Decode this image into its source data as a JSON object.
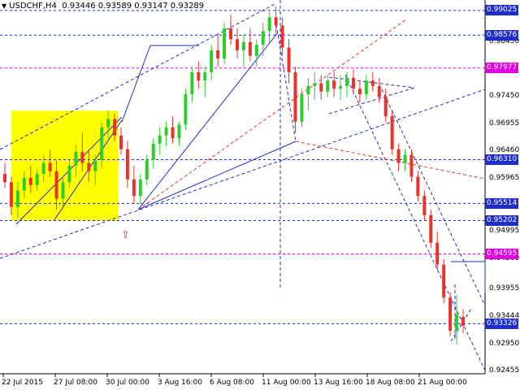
{
  "header": {
    "symbol": "USDCHF,H4",
    "ohlc": "0.93446 0.93589 0.93147 0.93289"
  },
  "chart_data": {
    "type": "candlestick",
    "title": "USDCHF,H4",
    "ohlc_text": "0.93446 0.93589 0.93147 0.93289",
    "ylim": [
      0.92415,
      0.99215
    ],
    "y_ticks": [
      "0.98450",
      "0.97450",
      "0.96955",
      "0.96460",
      "0.95965",
      "0.94995",
      "0.94500",
      "0.93955",
      "0.93444",
      "0.92950",
      "0.92455"
    ],
    "x_ticks": [
      "22 Jul 2015",
      "27 Jul 08:00",
      "30 Jul 00:00",
      "3 Aug 16:00",
      "6 Aug 08:00",
      "11 Aug 00:00",
      "13 Aug 16:00",
      "18 Aug 08:00",
      "21 Aug 00:00"
    ],
    "levels": [
      {
        "label": "0.99025",
        "value": 0.99025,
        "color": "#1f2ec8",
        "style": "dashed"
      },
      {
        "label": "0.98576",
        "value": 0.98576,
        "color": "#1f2ec8",
        "style": "dashed"
      },
      {
        "label": "0.97977",
        "value": 0.97977,
        "color": "#e000e0",
        "style": "dashed"
      },
      {
        "label": "0.96310",
        "value": 0.9631,
        "color": "#1f2ec8",
        "style": "dashed"
      },
      {
        "label": "0.95514",
        "value": 0.95514,
        "color": "#1f2ec8",
        "style": "dashed"
      },
      {
        "label": "0.95202",
        "value": 0.95202,
        "color": "#1f2ec8",
        "style": "dashed"
      },
      {
        "label": "0.94595",
        "value": 0.94595,
        "color": "#e000e0",
        "style": "dashed"
      },
      {
        "label": "0.93326",
        "value": 0.93326,
        "color": "#1f2ec8",
        "style": "dashed"
      }
    ],
    "series": [
      {
        "values": [
          [
            0.9605,
            0.9625,
            0.958,
            0.959
          ],
          [
            0.959,
            0.96,
            0.953,
            0.9545
          ],
          [
            0.9545,
            0.959,
            0.9525,
            0.9575
          ],
          [
            0.9575,
            0.961,
            0.956,
            0.9598
          ],
          [
            0.9598,
            0.962,
            0.957,
            0.9585
          ],
          [
            0.9585,
            0.9615,
            0.9575,
            0.9605
          ],
          [
            0.9605,
            0.964,
            0.959,
            0.9625
          ],
          [
            0.9625,
            0.965,
            0.96,
            0.961
          ],
          [
            0.961,
            0.963,
            0.954,
            0.956
          ],
          [
            0.956,
            0.96,
            0.9545,
            0.959
          ],
          [
            0.959,
            0.963,
            0.958,
            0.962
          ],
          [
            0.962,
            0.966,
            0.96,
            0.9645
          ],
          [
            0.9645,
            0.968,
            0.961,
            0.9625
          ],
          [
            0.9625,
            0.965,
            0.959,
            0.961
          ],
          [
            0.961,
            0.964,
            0.9585,
            0.963
          ],
          [
            0.963,
            0.97,
            0.9615,
            0.969
          ],
          [
            0.969,
            0.972,
            0.967,
            0.9705
          ],
          [
            0.9705,
            0.9715,
            0.9665,
            0.9675
          ],
          [
            0.9675,
            0.969,
            0.964,
            0.965
          ],
          [
            0.965,
            0.9665,
            0.958,
            0.9595
          ],
          [
            0.9595,
            0.962,
            0.955,
            0.9565
          ],
          [
            0.9565,
            0.9605,
            0.955,
            0.9595
          ],
          [
            0.9595,
            0.964,
            0.9585,
            0.963
          ],
          [
            0.963,
            0.967,
            0.9615,
            0.966
          ],
          [
            0.966,
            0.969,
            0.964,
            0.9675
          ],
          [
            0.9675,
            0.97,
            0.9655,
            0.969
          ],
          [
            0.969,
            0.971,
            0.966,
            0.967
          ],
          [
            0.967,
            0.97,
            0.9655,
            0.9695
          ],
          [
            0.9695,
            0.976,
            0.9685,
            0.975
          ],
          [
            0.975,
            0.98,
            0.9735,
            0.979
          ],
          [
            0.979,
            0.981,
            0.976,
            0.9775
          ],
          [
            0.9775,
            0.98,
            0.9745,
            0.979
          ],
          [
            0.979,
            0.984,
            0.9775,
            0.983
          ],
          [
            0.983,
            0.986,
            0.98,
            0.9815
          ],
          [
            0.9815,
            0.988,
            0.9805,
            0.987
          ],
          [
            0.987,
            0.9895,
            0.984,
            0.985
          ],
          [
            0.985,
            0.987,
            0.9815,
            0.983
          ],
          [
            0.983,
            0.986,
            0.98,
            0.9845
          ],
          [
            0.9845,
            0.987,
            0.981,
            0.982
          ],
          [
            0.982,
            0.985,
            0.98,
            0.984
          ],
          [
            0.984,
            0.988,
            0.982,
            0.9865
          ],
          [
            0.9865,
            0.99,
            0.9845,
            0.989
          ],
          [
            0.989,
            0.991,
            0.986,
            0.9875
          ],
          [
            0.9875,
            0.989,
            0.982,
            0.9835
          ],
          [
            0.9835,
            0.985,
            0.977,
            0.979
          ],
          [
            0.979,
            0.98,
            0.968,
            0.97
          ],
          [
            0.97,
            0.976,
            0.969,
            0.975
          ],
          [
            0.975,
            0.978,
            0.972,
            0.9765
          ],
          [
            0.9765,
            0.979,
            0.974,
            0.977
          ],
          [
            0.977,
            0.9785,
            0.974,
            0.9755
          ],
          [
            0.9755,
            0.9785,
            0.9745,
            0.9775
          ],
          [
            0.9775,
            0.979,
            0.9745,
            0.976
          ],
          [
            0.976,
            0.9785,
            0.974,
            0.9765
          ],
          [
            0.9765,
            0.979,
            0.9745,
            0.978
          ],
          [
            0.978,
            0.9795,
            0.975,
            0.976
          ],
          [
            0.976,
            0.9775,
            0.9735,
            0.975
          ],
          [
            0.975,
            0.9785,
            0.974,
            0.9775
          ],
          [
            0.9775,
            0.979,
            0.9755,
            0.9765
          ],
          [
            0.9765,
            0.978,
            0.9735,
            0.9745
          ],
          [
            0.9745,
            0.976,
            0.97,
            0.971
          ],
          [
            0.971,
            0.972,
            0.964,
            0.965
          ],
          [
            0.965,
            0.966,
            0.961,
            0.9625
          ],
          [
            0.9625,
            0.965,
            0.961,
            0.964
          ],
          [
            0.964,
            0.965,
            0.959,
            0.96
          ],
          [
            0.96,
            0.961,
            0.9555,
            0.9565
          ],
          [
            0.9565,
            0.9575,
            0.952,
            0.953
          ],
          [
            0.953,
            0.954,
            0.947,
            0.948
          ],
          [
            0.948,
            0.95,
            0.943,
            0.944
          ],
          [
            0.944,
            0.945,
            0.937,
            0.938
          ],
          [
            0.938,
            0.939,
            0.931,
            0.932
          ],
          [
            0.932,
            0.9385,
            0.9295,
            0.935
          ],
          [
            0.9345,
            0.9359,
            0.9315,
            0.9329
          ]
        ]
      }
    ],
    "annotations": [
      "yellow highlighted box 22 Jul 2015 - 30 Jul 00:00",
      "red up-arrow marker below box"
    ],
    "grid": false
  }
}
